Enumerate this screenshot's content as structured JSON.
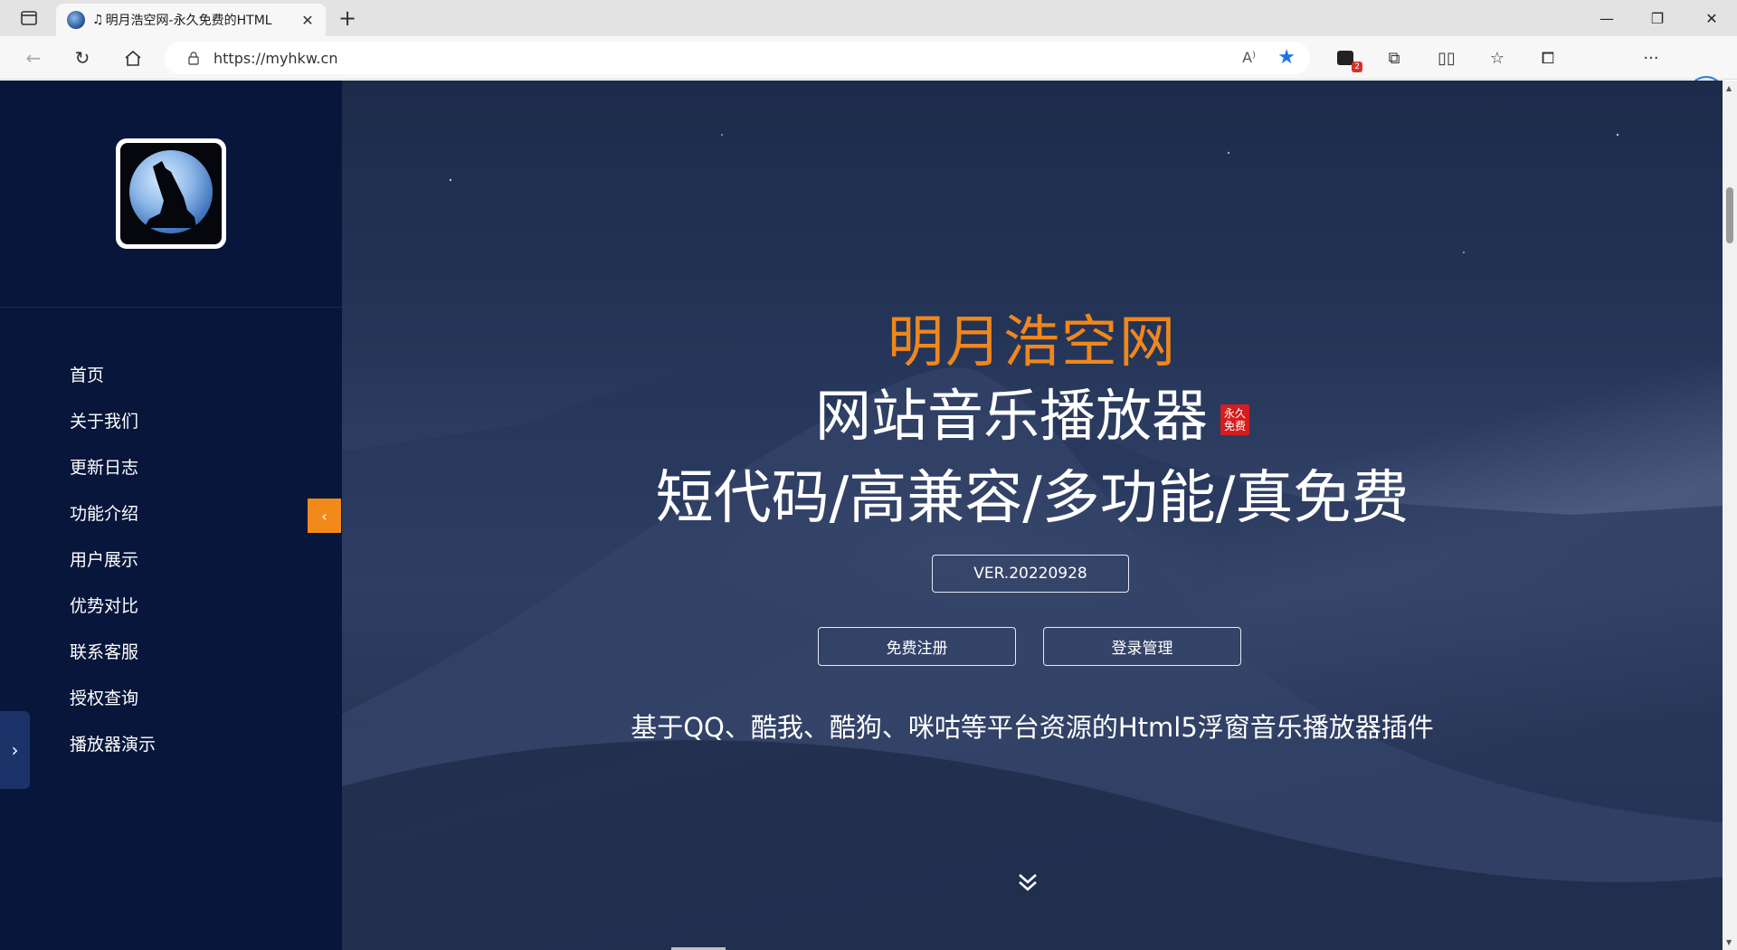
{
  "browser": {
    "tab_title": "明月浩空网-永久免费的HTML",
    "tab_note_glyph": "♫",
    "url": "https://myhkw.cn",
    "new_tab": "+",
    "extensions_badge": "2"
  },
  "sidebar": {
    "nav_items": [
      {
        "label": "首页"
      },
      {
        "label": "关于我们"
      },
      {
        "label": "更新日志"
      },
      {
        "label": "功能介绍"
      },
      {
        "label": "用户展示"
      },
      {
        "label": "优势对比"
      },
      {
        "label": "联系客服"
      },
      {
        "label": "授权查询"
      },
      {
        "label": "播放器演示"
      }
    ],
    "collapse_glyph": "‹",
    "toggle_glyph": "›"
  },
  "hero": {
    "brand": "明月浩空网",
    "subtitle1": "网站音乐播放器",
    "free_badge_line1": "永久",
    "free_badge_line2": "免费",
    "subtitle2": "短代码/高兼容/多功能/真免费",
    "version": "VER.20220928",
    "register_label": "免费注册",
    "login_label": "登录管理",
    "description": "基于QQ、酷我、酷狗、咪咕等平台资源的Html5浮窗音乐播放器插件"
  },
  "colors": {
    "sidebar_bg": "#07163a",
    "brand_orange": "#f0871c",
    "collapse_button": "#f28a1b",
    "free_badge": "#d51d1d"
  }
}
